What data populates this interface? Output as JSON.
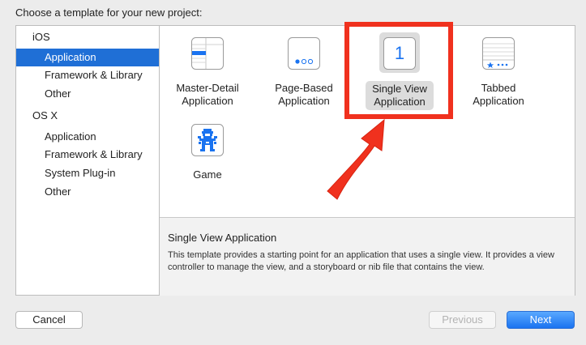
{
  "prompt": "Choose a template for your new project:",
  "sidebar": {
    "items": [
      {
        "label": "iOS"
      },
      {
        "label": "Application"
      },
      {
        "label": "Framework & Library"
      },
      {
        "label": "Other"
      },
      {
        "label": "OS X"
      },
      {
        "label": "Application"
      },
      {
        "label": "Framework & Library"
      },
      {
        "label": "System Plug-in"
      },
      {
        "label": "Other"
      }
    ]
  },
  "templates": [
    {
      "line1": "Master-Detail",
      "line2": "Application",
      "icon": "master-detail-icon"
    },
    {
      "line1": "Page-Based",
      "line2": "Application",
      "icon": "page-based-icon"
    },
    {
      "line1": "Single View",
      "line2": "Application",
      "icon": "single-view-icon",
      "icon_text": "1"
    },
    {
      "line1": "Tabbed",
      "line2": "Application",
      "icon": "tabbed-icon"
    },
    {
      "line1": "Game",
      "line2": "",
      "icon": "game-icon"
    }
  ],
  "description": {
    "title": "Single View Application",
    "text": "This template provides a starting point for an application that uses a single view. It provides a view controller to manage the view, and a storyboard or nib file that contains the view."
  },
  "buttons": {
    "cancel": "Cancel",
    "previous": "Previous",
    "next": "Next"
  },
  "colors": {
    "selection": "#1f6fd6",
    "annotation": "#f0311e",
    "icon_blue": "#1a73f0"
  }
}
